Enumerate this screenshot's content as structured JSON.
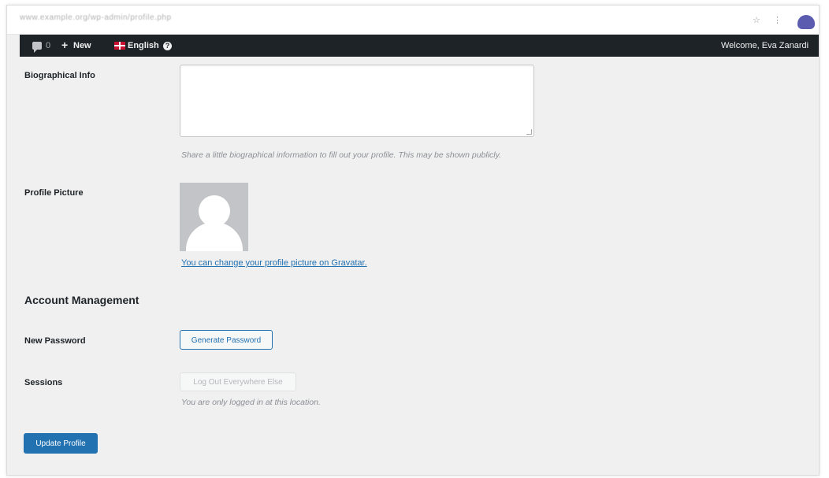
{
  "browser": {
    "url": "www.example.org/wp-admin/profile.php",
    "controls": [
      "☆",
      "⋮"
    ]
  },
  "admin_bar": {
    "comments_count": "0",
    "new_label": "New",
    "language_label": "English",
    "welcome_text": "Welcome, Eva Zanardi"
  },
  "profile": {
    "bio_label": "Biographical Info",
    "bio_value": "",
    "bio_description": "Share a little biographical information to fill out your profile. This may be shown publicly.",
    "picture_label": "Profile Picture",
    "gravatar_link": "You can change your profile picture on Gravatar."
  },
  "account": {
    "section_title": "Account Management",
    "password_label": "New Password",
    "generate_button": "Generate Password",
    "sessions_label": "Sessions",
    "logout_button": "Log Out Everywhere Else",
    "sessions_description": "You are only logged in at this location."
  },
  "update_button": "Update Profile",
  "icons": {
    "comment": "comment-icon",
    "plus": "plus-icon",
    "flag": "uk-flag-icon",
    "help": "help-icon"
  },
  "colors": {
    "admin_bar": "#1d2327",
    "primary": "#2271b1",
    "page_bg": "#f0f0f1"
  }
}
